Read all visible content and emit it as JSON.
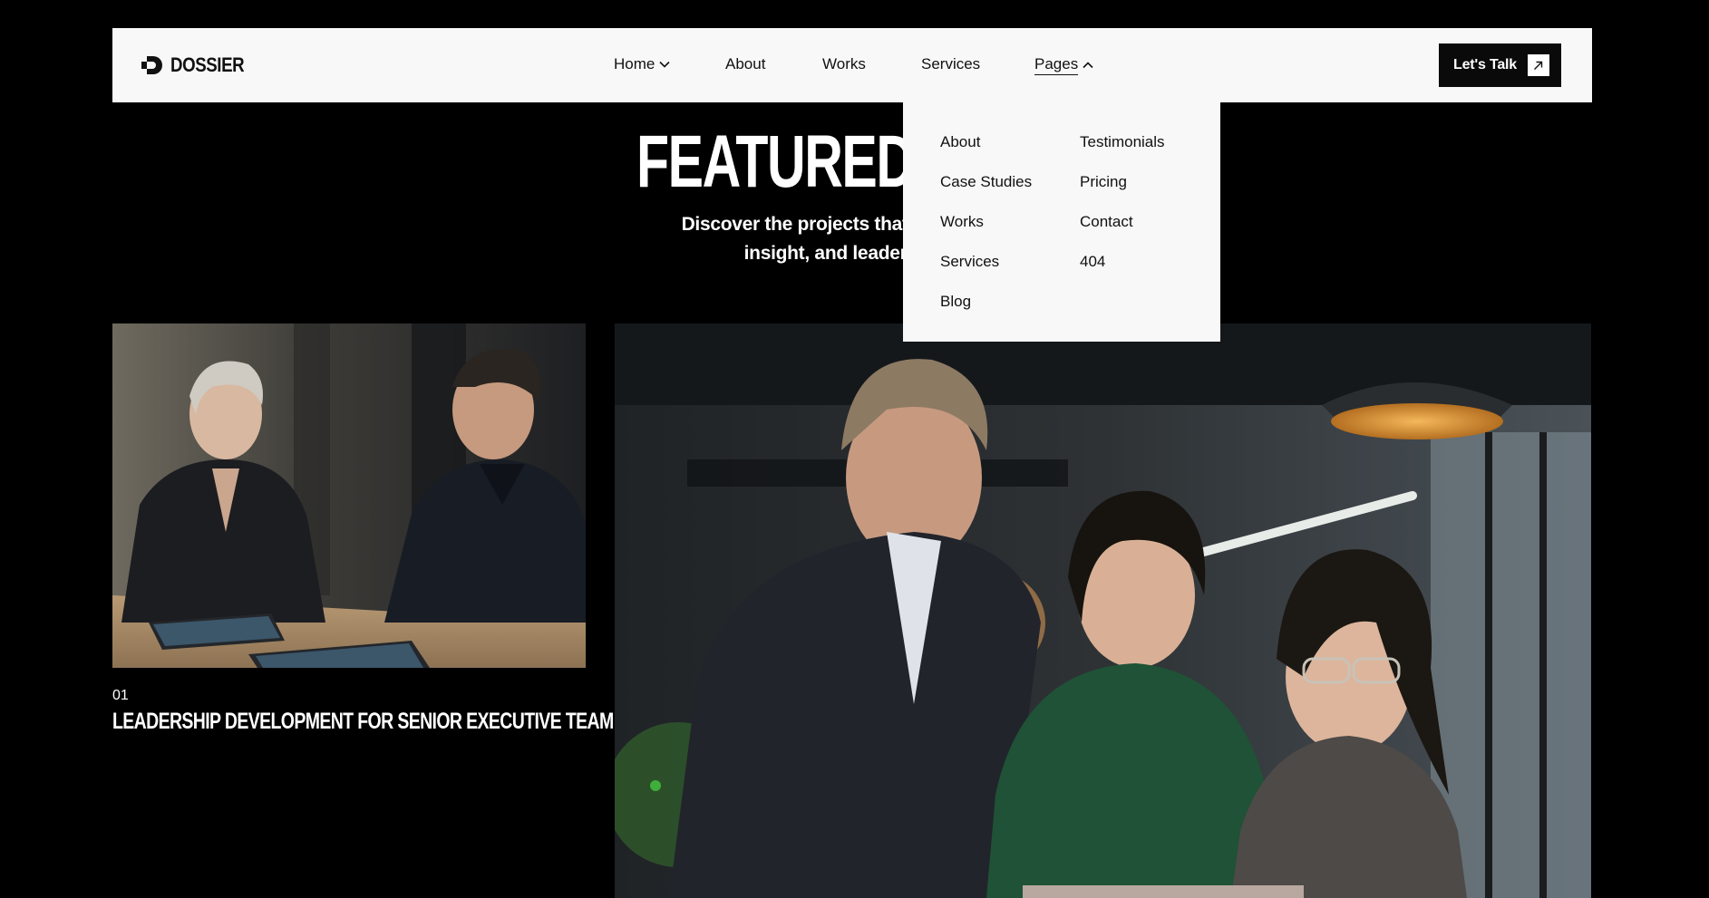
{
  "brand": {
    "name": "DOSSIER",
    "logo_icon": "dossier-logo-mark"
  },
  "nav": {
    "items": [
      {
        "label": "Home",
        "has_chevron": true,
        "chevron": "chevron-down-icon"
      },
      {
        "label": "About"
      },
      {
        "label": "Works"
      },
      {
        "label": "Services"
      },
      {
        "label": "Pages",
        "has_chevron": true,
        "chevron": "chevron-up-icon",
        "active": true
      }
    ],
    "cta": {
      "label": "Let's Talk",
      "icon": "arrow-up-right-icon"
    }
  },
  "dropdown": {
    "column_1": [
      "About",
      "Case Studies",
      "Works",
      "Services",
      "Blog"
    ],
    "column_2": [
      "Testimonials",
      "Pricing",
      "Contact",
      "404"
    ]
  },
  "hero": {
    "title_visible": "FEATURED W",
    "description_line_1": "Discover the projects that highlight me",
    "description_line_2": "insight, and leadership e"
  },
  "works": [
    {
      "number": "01",
      "title": "LEADERSHIP DEVELOPMENT FOR SENIOR EXECUTIVE TEAM",
      "image": "photo of two executives writing on tablets at a wooden table"
    },
    {
      "image": "photo of three colleagues in a modern office looking at a laptop"
    }
  ],
  "colors": {
    "page_background": "#000000",
    "nav_background": "#f8f8f8",
    "cta_background": "#0a0a0a",
    "text_dark": "#111111",
    "text_light": "#ffffff"
  }
}
